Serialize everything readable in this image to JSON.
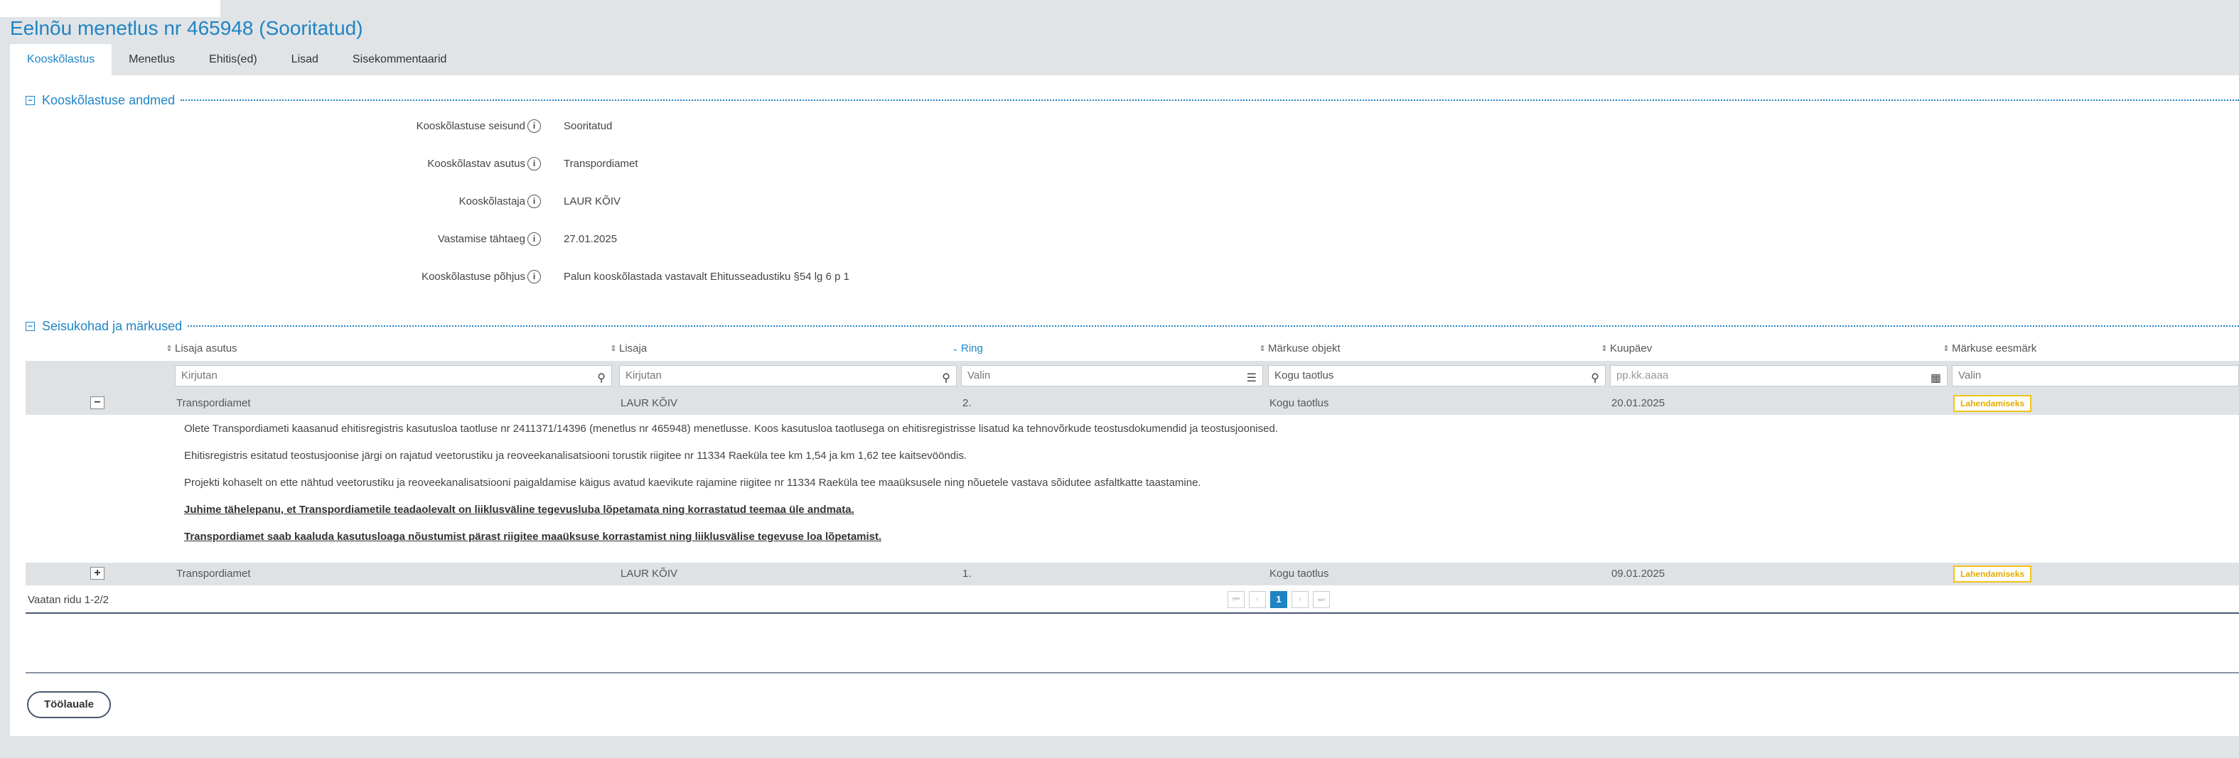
{
  "page": {
    "title": "Eelnõu menetlus nr 465948 (Sooritatud)"
  },
  "tabs": [
    {
      "label": "Kooskõlastus",
      "active": true
    },
    {
      "label": "Menetlus"
    },
    {
      "label": "Ehitis(ed)"
    },
    {
      "label": "Lisad"
    },
    {
      "label": "Sisekommentaarid"
    }
  ],
  "details": {
    "section_title": "Kooskõlastuse andmed",
    "fields": [
      {
        "label": "Kooskõlastuse seisund",
        "value": "Sooritatud"
      },
      {
        "label": "Kooskõlastav asutus",
        "value": "Transpordiamet"
      },
      {
        "label": "Kooskõlastaja",
        "value": "LAUR KÕIV"
      },
      {
        "label": "Vastamise tähtaeg",
        "value": "27.01.2025"
      },
      {
        "label": "Kooskõlastuse põhjus",
        "value": "Palun kooskõlastada vastavalt Ehitusseadustiku §54 lg 6 p 1"
      }
    ],
    "info_glyph": "i"
  },
  "remarks": {
    "section_title": "Seisukohad ja märkused",
    "columns": [
      "Lisaja asutus",
      "Lisaja",
      "Ring",
      "Märkuse objekt",
      "Kuupäev",
      "Märkuse eesmärk"
    ],
    "sorted_column": "Ring",
    "filters": {
      "asutus_placeholder": "Kirjutan",
      "lisaja_placeholder": "Kirjutan",
      "ring_value": "Valin",
      "objekt_value": "Kogu taotlus",
      "kuupaev_placeholder": "pp.kk.aaaa",
      "eesmark_value": "Valin"
    },
    "rows": [
      {
        "toggle": "−",
        "asutus": "Transpordiamet",
        "lisaja": "LAUR KÕIV",
        "ring": "2.",
        "objekt": "Kogu taotlus",
        "kuupaev": "20.01.2025",
        "eesmark": "Lahendamiseks",
        "details": [
          "Olete Transpordiameti kaasanud ehitisregistris kasutusloa taotluse nr 2411371/14396 (menetlus nr 465948) menetlusse. Koos kasutusloa taotlusega on ehitisregistrisse lisatud ka tehnovõrkude teostusdokumendid ja teostusjoonised.",
          "Ehitisregistris esitatud teostusjoonise järgi on rajatud veetorustiku ja reoveekanalisatsiooni torustik riigitee nr 11334 Raeküla tee km 1,54 ja km 1,62 tee kaitsevööndis.",
          "Projekti kohaselt on ette nähtud veetorustiku ja reoveekanalisatsiooni paigaldamise käigus avatud kaevikute rajamine riigitee nr 11334 Raeküla tee maaüksusele ning nõuetele vastava sõidutee asfaltkatte taastamine.",
          "Juhime tähelepanu, et Transpordiametile teadaolevalt on liiklusväline tegevusluba lõpetamata ning korrastatud teemaa üle andmata.",
          "Transpordiamet saab kaaluda kasutusloaga nõustumist pärast riigitee maaüksuse korrastamist ning liiklusvälise tegevuse loa lõpetamist."
        ]
      },
      {
        "toggle": "+",
        "asutus": "Transpordiamet",
        "lisaja": "LAUR KÕIV",
        "ring": "1.",
        "objekt": "Kogu taotlus",
        "kuupaev": "09.01.2025",
        "eesmark": "Lahendamiseks"
      }
    ],
    "row_count_text": "Vaatan ridu 1-2/2",
    "pager": {
      "first": "⏮",
      "prev": "‹",
      "current": "1",
      "next": "›",
      "last": "⏭"
    }
  },
  "colors": {
    "accent": "#1f84c4",
    "badge": "#f2c318",
    "background": "#e1e4e7"
  },
  "actions": {
    "back_label": "Töölauale"
  }
}
